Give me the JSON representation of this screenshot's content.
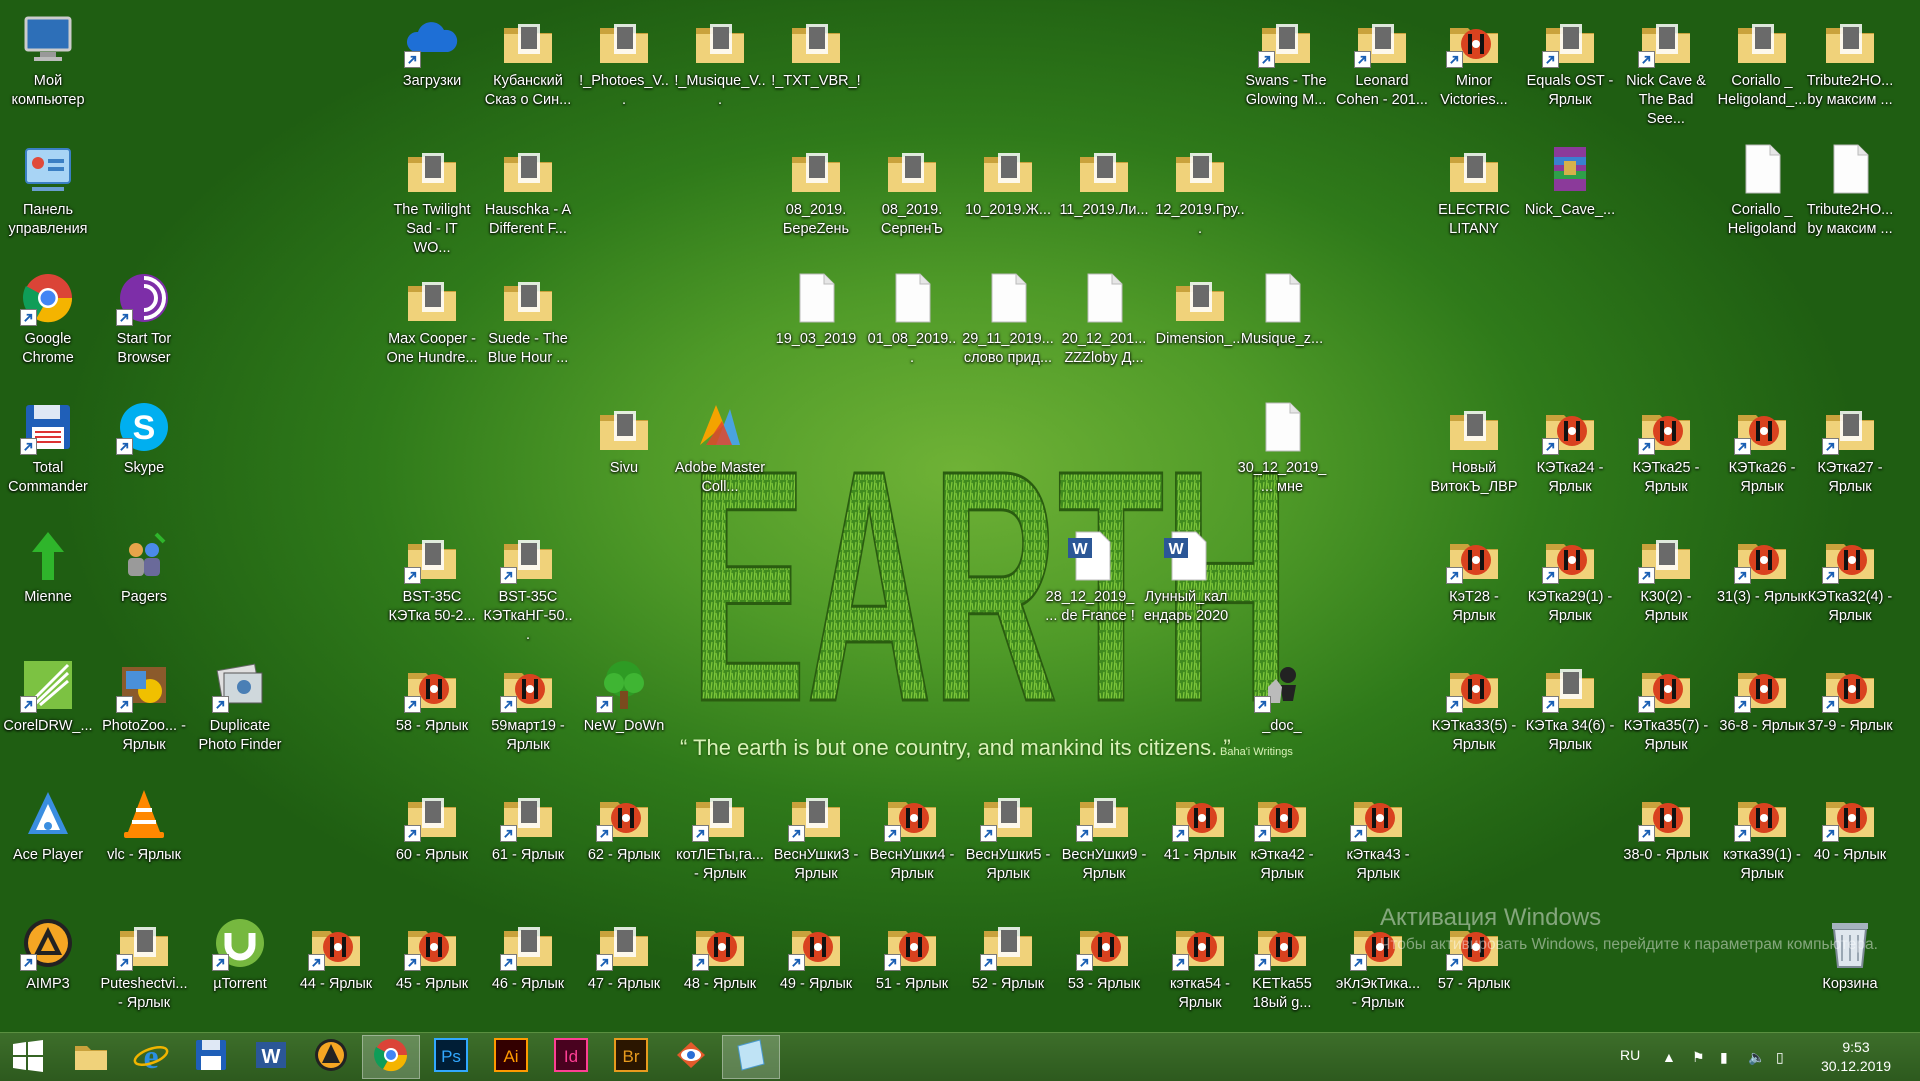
{
  "desktop": {
    "icons": [
      {
        "label": "Мой компьютер",
        "icon": "computer-icon",
        "col": 0,
        "row": 0,
        "shortcut": false
      },
      {
        "label": "Панель управления",
        "icon": "control-panel-icon",
        "col": 0,
        "row": 1,
        "shortcut": false
      },
      {
        "label": "Google Chrome",
        "icon": "chrome-icon",
        "col": 0,
        "row": 2,
        "shortcut": true
      },
      {
        "label": "Total Commander",
        "icon": "floppy-icon",
        "col": 0,
        "row": 3,
        "shortcut": true
      },
      {
        "label": "Mienne",
        "icon": "green-arrow-icon",
        "col": 0,
        "row": 4,
        "shortcut": false
      },
      {
        "label": "CorelDRW_...",
        "icon": "coreldraw-icon",
        "col": 0,
        "row": 5,
        "shortcut": true
      },
      {
        "label": "Ace Player",
        "icon": "ace-player-icon",
        "col": 0,
        "row": 6,
        "shortcut": false
      },
      {
        "label": "AIMP3",
        "icon": "aimp-icon",
        "col": 0,
        "row": 7,
        "shortcut": true
      },
      {
        "label": "Start Tor Browser",
        "icon": "tor-icon",
        "col": 1,
        "row": 2,
        "shortcut": true
      },
      {
        "label": "Skype",
        "icon": "skype-icon",
        "col": 1,
        "row": 3,
        "shortcut": true
      },
      {
        "label": "Pagers",
        "icon": "pagers-icon",
        "col": 1,
        "row": 4,
        "shortcut": false
      },
      {
        "label": "PhotoZoo... - Ярлык",
        "icon": "photozoom-icon",
        "col": 1,
        "row": 5,
        "shortcut": true
      },
      {
        "label": "vlc - Ярлык",
        "icon": "vlc-icon",
        "col": 1,
        "row": 6,
        "shortcut": false
      },
      {
        "label": "Puteshectvi... - Ярлык",
        "icon": "folder-icon",
        "col": 1,
        "row": 7,
        "shortcut": true
      },
      {
        "label": "Duplicate Photo Finder",
        "icon": "photo-finder-icon",
        "col": 2,
        "row": 5,
        "shortcut": true
      },
      {
        "label": "µTorrent",
        "icon": "utorrent-icon",
        "col": 2,
        "row": 7,
        "shortcut": true
      },
      {
        "label": "44 - Ярлык",
        "icon": "music-folder-icon",
        "col": 3,
        "row": 7,
        "shortcut": true
      },
      {
        "label": "Загрузки",
        "icon": "cloud-icon",
        "col": 4,
        "row": 0,
        "shortcut": true
      },
      {
        "label": "The Twilight Sad - IT WO...",
        "icon": "folder-icon",
        "col": 4,
        "row": 1,
        "shortcut": false
      },
      {
        "label": "Max Cooper - One Hundre...",
        "icon": "folder-icon",
        "col": 4,
        "row": 2,
        "shortcut": false
      },
      {
        "label": "BST-35C КЭТка 50-2...",
        "icon": "folder-icon",
        "col": 4,
        "row": 4,
        "shortcut": true
      },
      {
        "label": "58 - Ярлык",
        "icon": "music-folder-icon",
        "col": 4,
        "row": 5,
        "shortcut": true
      },
      {
        "label": "60 - Ярлык",
        "icon": "folder-icon",
        "col": 4,
        "row": 6,
        "shortcut": true
      },
      {
        "label": "45 - Ярлык",
        "icon": "music-folder-icon",
        "col": 4,
        "row": 7,
        "shortcut": true
      },
      {
        "label": "Кубанский Сказ о Син...",
        "icon": "folder-icon",
        "col": 5,
        "row": 0,
        "shortcut": false
      },
      {
        "label": "Hauschka - A Different F...",
        "icon": "folder-icon",
        "col": 5,
        "row": 1,
        "shortcut": false
      },
      {
        "label": "Suede - The Blue Hour ...",
        "icon": "folder-icon",
        "col": 5,
        "row": 2,
        "shortcut": false
      },
      {
        "label": "BST-35C КЭТкаНГ-50...",
        "icon": "folder-icon",
        "col": 5,
        "row": 4,
        "shortcut": true
      },
      {
        "label": "59март19 - Ярлык",
        "icon": "music-folder-icon",
        "col": 5,
        "row": 5,
        "shortcut": true
      },
      {
        "label": "61 - Ярлык",
        "icon": "folder-icon",
        "col": 5,
        "row": 6,
        "shortcut": true
      },
      {
        "label": "46 - Ярлык",
        "icon": "folder-icon",
        "col": 5,
        "row": 7,
        "shortcut": true
      },
      {
        "label": "!_Photoes_V...",
        "icon": "folder-icon",
        "col": 6,
        "row": 0,
        "shortcut": false
      },
      {
        "label": "Sivu",
        "icon": "folder-icon",
        "col": 6,
        "row": 3,
        "shortcut": false
      },
      {
        "label": "NeW_DoWn",
        "icon": "tree-icon",
        "col": 6,
        "row": 5,
        "shortcut": true
      },
      {
        "label": "62 - Ярлык",
        "icon": "music-folder-icon",
        "col": 6,
        "row": 6,
        "shortcut": true
      },
      {
        "label": "47 - Ярлык",
        "icon": "folder-icon",
        "col": 6,
        "row": 7,
        "shortcut": true
      },
      {
        "label": "!_Musique_V...",
        "icon": "folder-icon",
        "col": 7,
        "row": 0,
        "shortcut": false
      },
      {
        "label": "Adobe Master Coll...",
        "icon": "adobe-master-icon",
        "col": 7,
        "row": 3,
        "shortcut": false
      },
      {
        "label": "котЛЕТы,га... - Ярлык",
        "icon": "folder-icon",
        "col": 7,
        "row": 6,
        "shortcut": true
      },
      {
        "label": "48 - Ярлык",
        "icon": "music-folder-icon",
        "col": 7,
        "row": 7,
        "shortcut": true
      },
      {
        "label": "!_TXT_VBR_!",
        "icon": "folder-icon",
        "col": 8,
        "row": 0,
        "shortcut": false
      },
      {
        "label": "08_2019. БереZень",
        "icon": "folder-icon",
        "col": 8,
        "row": 1,
        "shortcut": false
      },
      {
        "label": "19_03_2019",
        "icon": "document-icon",
        "col": 8,
        "row": 2,
        "shortcut": false
      },
      {
        "label": "ВеснУшки3 - Ярлык",
        "icon": "folder-icon",
        "col": 8,
        "row": 6,
        "shortcut": true
      },
      {
        "label": "49 - Ярлык",
        "icon": "music-folder-icon",
        "col": 8,
        "row": 7,
        "shortcut": true
      },
      {
        "label": "08_2019. СерпенЪ",
        "icon": "folder-icon",
        "col": 9,
        "row": 1,
        "shortcut": false
      },
      {
        "label": "01_08_2019...",
        "icon": "document-icon",
        "col": 9,
        "row": 2,
        "shortcut": false
      },
      {
        "label": "ВеснУшки4 - Ярлык",
        "icon": "music-folder-icon",
        "col": 9,
        "row": 6,
        "shortcut": true
      },
      {
        "label": "51 - Ярлык",
        "icon": "music-folder-icon",
        "col": 9,
        "row": 7,
        "shortcut": true
      },
      {
        "label": "10_2019.Ж...",
        "icon": "folder-icon",
        "col": 10,
        "row": 1,
        "shortcut": false
      },
      {
        "label": "29_11_2019... слово прид...",
        "icon": "document-icon",
        "col": 10,
        "row": 2,
        "shortcut": false
      },
      {
        "label": "ВеснУшки5 - Ярлык",
        "icon": "folder-icon",
        "col": 10,
        "row": 6,
        "shortcut": true
      },
      {
        "label": "52 - Ярлык",
        "icon": "folder-icon",
        "col": 10,
        "row": 7,
        "shortcut": true
      },
      {
        "label": "11_2019.Ли...",
        "icon": "folder-icon",
        "col": 11,
        "row": 1,
        "shortcut": false
      },
      {
        "label": "20_12_201... ZZZloby Д...",
        "icon": "document-icon",
        "col": 11,
        "row": 2,
        "shortcut": false
      },
      {
        "label": "28_12_2019_... de France !",
        "icon": "word-doc-icon",
        "col": 11,
        "row": 4,
        "shortcut": false
      },
      {
        "label": "ВеснУшки9 - Ярлык",
        "icon": "folder-icon",
        "col": 11,
        "row": 6,
        "shortcut": true
      },
      {
        "label": "53 - Ярлык",
        "icon": "music-folder-icon",
        "col": 11,
        "row": 7,
        "shortcut": true
      },
      {
        "label": "12_2019.Гру...",
        "icon": "folder-icon",
        "col": 12,
        "row": 1,
        "shortcut": false
      },
      {
        "label": "Dimension_...",
        "icon": "folder-icon",
        "col": 12,
        "row": 2,
        "shortcut": false
      },
      {
        "label": "Лунный_кал ендарь 2020",
        "icon": "word-doc-icon",
        "col": 12,
        "row": 4,
        "shortcut": false
      },
      {
        "label": "41 - Ярлык",
        "icon": "music-folder-icon",
        "col": 12,
        "row": 6,
        "shortcut": true
      },
      {
        "label": "кэтка54 - Ярлык",
        "icon": "music-folder-icon",
        "col": 12,
        "row": 7,
        "shortcut": true
      },
      {
        "label": "Musique_z...",
        "icon": "document-icon",
        "col": 13,
        "row": 2,
        "shortcut": false
      },
      {
        "label": "30_12_2019_... мне",
        "icon": "document-icon",
        "col": 13,
        "row": 3,
        "shortcut": false
      },
      {
        "label": "_doc_",
        "icon": "chess-icon",
        "col": 13,
        "row": 5,
        "shortcut": true
      },
      {
        "label": "кЭтка42 - Ярлык",
        "icon": "music-folder-icon",
        "col": 13,
        "row": 6,
        "shortcut": true
      },
      {
        "label": "KETka55 18ый g...",
        "icon": "music-folder-icon",
        "col": 13,
        "row": 7,
        "shortcut": true
      },
      {
        "label": "Swans - The Glowing M...",
        "icon": "folder-icon",
        "col": 13,
        "row": 0,
        "shortcut": true
      },
      {
        "label": "кЭтка43 - Ярлык",
        "icon": "music-folder-icon",
        "col": 14,
        "row": 6,
        "shortcut": true
      },
      {
        "label": "эКлЭкТика... - Ярлык",
        "icon": "music-folder-icon",
        "col": 14,
        "row": 7,
        "shortcut": true
      },
      {
        "label": "Leonard Cohen - 201...",
        "icon": "folder-icon",
        "col": 14,
        "row": 0,
        "shortcut": true
      },
      {
        "label": "Minor Victories...",
        "icon": "music-folder-icon",
        "col": 15,
        "row": 0,
        "shortcut": true
      },
      {
        "label": "ELECTRIC LITANY",
        "icon": "folder-icon",
        "col": 15,
        "row": 1,
        "shortcut": false
      },
      {
        "label": "Новый ВитокЪ_ЛВР",
        "icon": "folder-icon",
        "col": 15,
        "row": 3,
        "shortcut": false
      },
      {
        "label": "КэТ28 - Ярлык",
        "icon": "music-folder-icon",
        "col": 15,
        "row": 4,
        "shortcut": true
      },
      {
        "label": "КЭТка33(5) - Ярлык",
        "icon": "music-folder-icon",
        "col": 15,
        "row": 5,
        "shortcut": true
      },
      {
        "label": "57 - Ярлык",
        "icon": "music-folder-icon",
        "col": 15,
        "row": 7,
        "shortcut": true
      },
      {
        "label": "Equals OST - Ярлык",
        "icon": "folder-icon",
        "col": 16,
        "row": 0,
        "shortcut": true
      },
      {
        "label": "Nick_Cave_...",
        "icon": "winrar-icon",
        "col": 16,
        "row": 1,
        "shortcut": false
      },
      {
        "label": "КЭТка24 - Ярлык",
        "icon": "music-folder-icon",
        "col": 16,
        "row": 3,
        "shortcut": true
      },
      {
        "label": "КЭТка29(1) - Ярлык",
        "icon": "music-folder-icon",
        "col": 16,
        "row": 4,
        "shortcut": true
      },
      {
        "label": "КЭТка 34(6) - Ярлык",
        "icon": "folder-icon",
        "col": 16,
        "row": 5,
        "shortcut": true
      },
      {
        "label": "Nick Cave & The Bad See...",
        "icon": "folder-icon",
        "col": 17,
        "row": 0,
        "shortcut": true
      },
      {
        "label": "КЭТка25 - Ярлык",
        "icon": "music-folder-icon",
        "col": 17,
        "row": 3,
        "shortcut": true
      },
      {
        "label": "К30(2) - Ярлык",
        "icon": "folder-icon",
        "col": 17,
        "row": 4,
        "shortcut": true
      },
      {
        "label": "КЭТка35(7) - Ярлык",
        "icon": "music-folder-icon",
        "col": 17,
        "row": 5,
        "shortcut": true
      },
      {
        "label": "38-0 - Ярлык",
        "icon": "music-folder-icon",
        "col": 17,
        "row": 6,
        "shortcut": true
      },
      {
        "label": "Coriallo _ Heligoland_...",
        "icon": "folder-icon",
        "col": 18,
        "row": 0,
        "shortcut": false
      },
      {
        "label": "Coriallo _ Heligoland",
        "icon": "document-icon",
        "col": 18,
        "row": 1,
        "shortcut": false
      },
      {
        "label": "КЭТка26 - Ярлык",
        "icon": "music-folder-icon",
        "col": 18,
        "row": 3,
        "shortcut": true
      },
      {
        "label": "31(3) - Ярлык",
        "icon": "music-folder-icon",
        "col": 18,
        "row": 4,
        "shortcut": true
      },
      {
        "label": "36-8 - Ярлык",
        "icon": "music-folder-icon",
        "col": 18,
        "row": 5,
        "shortcut": true
      },
      {
        "label": "кэтка39(1) - Ярлык",
        "icon": "music-folder-icon",
        "col": 18,
        "row": 6,
        "shortcut": true
      },
      {
        "label": "Tribute2HO... by максим ...",
        "icon": "folder-icon",
        "col": 19,
        "row": 0,
        "shortcut": false
      },
      {
        "label": "Tribute2HO... by максим ...",
        "icon": "document-icon",
        "col": 19,
        "row": 1,
        "shortcut": false
      },
      {
        "label": "КЭтка27 - Ярлык",
        "icon": "folder-icon",
        "col": 19,
        "row": 3,
        "shortcut": true
      },
      {
        "label": "КЭТка32(4) - Ярлык",
        "icon": "music-folder-icon",
        "col": 19,
        "row": 4,
        "shortcut": true
      },
      {
        "label": "37-9 - Ярлык",
        "icon": "music-folder-icon",
        "col": 19,
        "row": 5,
        "shortcut": true
      },
      {
        "label": "40 - Ярлык",
        "icon": "music-folder-icon",
        "col": 19,
        "row": 6,
        "shortcut": true
      },
      {
        "label": "Корзина",
        "icon": "recycle-bin-icon",
        "col": 19,
        "row": 7,
        "shortcut": false
      }
    ]
  },
  "wallpaper": {
    "title": "EARTH",
    "quote": "“ The earth is but one country, and mankind its citizens. ”",
    "quote_source": "Baha'i Writings"
  },
  "activation": {
    "heading": "Активация Windows",
    "sub": "Чтобы активировать Windows, перейдите к параметрам компьютера."
  },
  "taskbar": {
    "buttons": [
      {
        "name": "start-button",
        "icon": "windows-logo-icon"
      },
      {
        "name": "explorer-button",
        "icon": "folder-icon"
      },
      {
        "name": "ie-button",
        "icon": "internet-explorer-icon"
      },
      {
        "name": "total-commander-button",
        "icon": "floppy-icon"
      },
      {
        "name": "word-button",
        "icon": "word-icon"
      },
      {
        "name": "aimp-button",
        "icon": "aimp-icon"
      },
      {
        "name": "chrome-button",
        "icon": "chrome-icon",
        "active": true
      },
      {
        "name": "photoshop-button",
        "icon": "photoshop-icon",
        "text": "Ps"
      },
      {
        "name": "illustrator-button",
        "icon": "illustrator-icon",
        "text": "Ai"
      },
      {
        "name": "indesign-button",
        "icon": "indesign-icon",
        "text": "Id"
      },
      {
        "name": "bridge-button",
        "icon": "bridge-icon",
        "text": "Br"
      },
      {
        "name": "eye-app-button",
        "icon": "eye-icon"
      },
      {
        "name": "notes-button",
        "icon": "notes-icon",
        "active": true
      }
    ],
    "tray": {
      "language": "RU",
      "time": "9:53",
      "date": "30.12.2019"
    }
  },
  "colors": {
    "taskbar": "#2d5a1e",
    "folder": "#e8c86a",
    "ps": "#31a8ff",
    "ai": "#ff9a00",
    "id": "#ff3f94",
    "br": "#e89b1e"
  }
}
